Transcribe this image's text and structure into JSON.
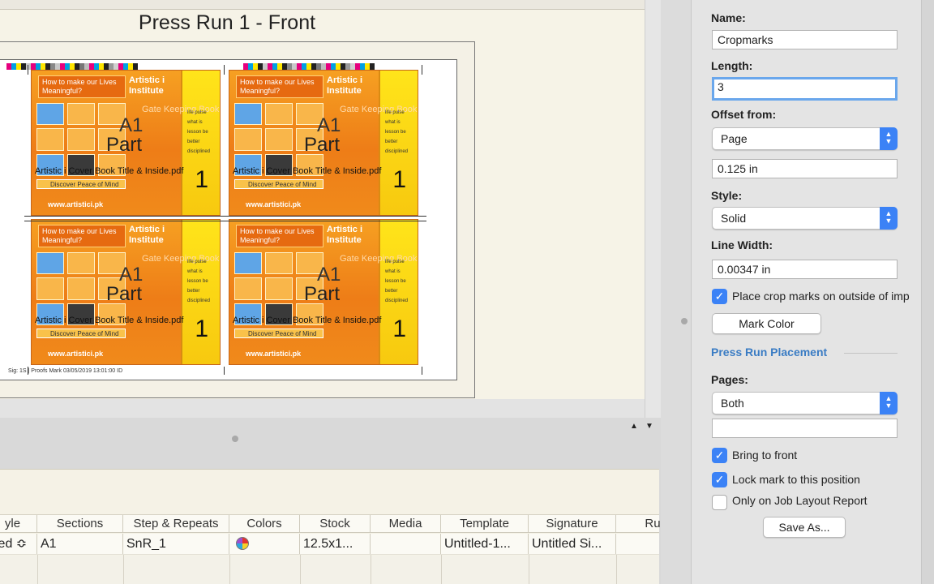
{
  "preview": {
    "title": "Press Run 1 - Front",
    "slug_text": "Sig: 1S  |  Proofs Mark 03/05/2019 13:01:00 ID",
    "panel": {
      "question": "How to make our Lives Meaningful?",
      "institute": "Artistic i Institute",
      "book_words": "Gate Keeping Book",
      "letter": "A1",
      "part": "Part",
      "filename": "Artistic i Cover Book Title & Inside.pdf",
      "discover": "Discover Peace of Mind",
      "url": "www.artistici.pk",
      "number": "1",
      "scribble": "life pulse what is lesson be better disciplined"
    },
    "colorbar_colors": [
      "#e6007e",
      "#00a0e3",
      "#ffe600",
      "#222222",
      "#c8c8c8",
      "#e6007e",
      "#00a0e3",
      "#ffe600",
      "#222222",
      "#888888",
      "#c8c8c8",
      "#e6007e",
      "#00a0e3",
      "#ffe600",
      "#222222",
      "#777777",
      "#bdbdbd",
      "#e6007e",
      "#00a0e3",
      "#ffe600",
      "#222222",
      "#999999",
      "#d0d0d0",
      "#e6007e",
      "#00a0e3",
      "#ffe600",
      "#222222"
    ]
  },
  "splitter": {
    "up_arrow": "▲",
    "down_arrow": "▼"
  },
  "table": {
    "columns": [
      "yle",
      "Sections",
      "Step & Repeats",
      "Colors",
      "Stock",
      "Media",
      "Template",
      "Signature",
      "Ru"
    ],
    "row": {
      "style": "led ≎",
      "sections": "A1",
      "step_repeats": "SnR_1",
      "stock": "12.5x1...",
      "media": "",
      "template": "Untitled-1...",
      "signature": "Untitled Si..."
    }
  },
  "inspector": {
    "name_label": "Name:",
    "name_value": "Cropmarks",
    "length_label": "Length:",
    "length_value": "3",
    "offset_label": "Offset from:",
    "offset_value": "Page",
    "offset_amount": "0.125 in",
    "style_label": "Style:",
    "style_value": "Solid",
    "linewidth_label": "Line Width:",
    "linewidth_value": "0.00347 in",
    "place_outside_label": "Place crop marks on outside of imp",
    "mark_color_button": "Mark Color",
    "placement_section": "Press Run Placement",
    "pages_label": "Pages:",
    "pages_value": "Both",
    "pages_extra_value": "",
    "bring_front_label": "Bring to front",
    "lock_label": "Lock mark to this position",
    "job_report_label": "Only on Job Layout Report",
    "save_as_button": "Save As...",
    "checks": {
      "place_outside": true,
      "bring_front": true,
      "lock": true,
      "job_report": false
    },
    "accent_color": "#3b82f6",
    "section_color": "#3a7cc4"
  }
}
